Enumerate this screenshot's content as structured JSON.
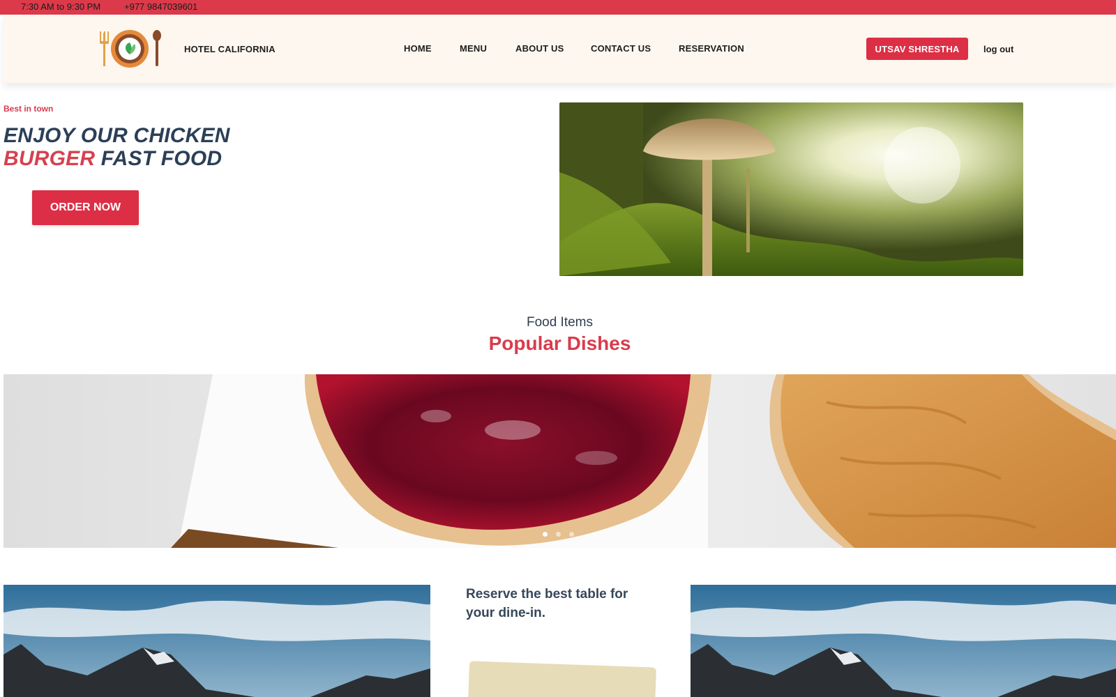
{
  "topbar": {
    "hours": "7:30 AM to 9:30 PM",
    "phone": "+977 9847039601"
  },
  "header": {
    "brand": "HOTEL CALIFORNIA",
    "nav": [
      "HOME",
      "MENU",
      "ABOUT US",
      "CONTACT US",
      "RESERVATION"
    ],
    "user_button": "UTSAV SHRESTHA",
    "logout": "log out"
  },
  "hero": {
    "tagline": "Best in town",
    "title_line1": "ENJOY OUR CHICKEN",
    "title_red": "BURGER",
    "title_line2_rest": " FAST FOOD",
    "order_button": "ORDER NOW",
    "image_icon": "mushroom-photo"
  },
  "section": {
    "subtitle": "Food Items",
    "title": "Popular Dishes"
  },
  "carousel": {
    "slide_count": 3,
    "active_slide": 1
  },
  "reserve": {
    "text": "Reserve the best table for your dine-in."
  },
  "colors": {
    "accent": "#dc2f45",
    "topbar": "#dc3a4a",
    "header_bg": "#fdf7ef",
    "heading_blue": "#2b3f57"
  }
}
